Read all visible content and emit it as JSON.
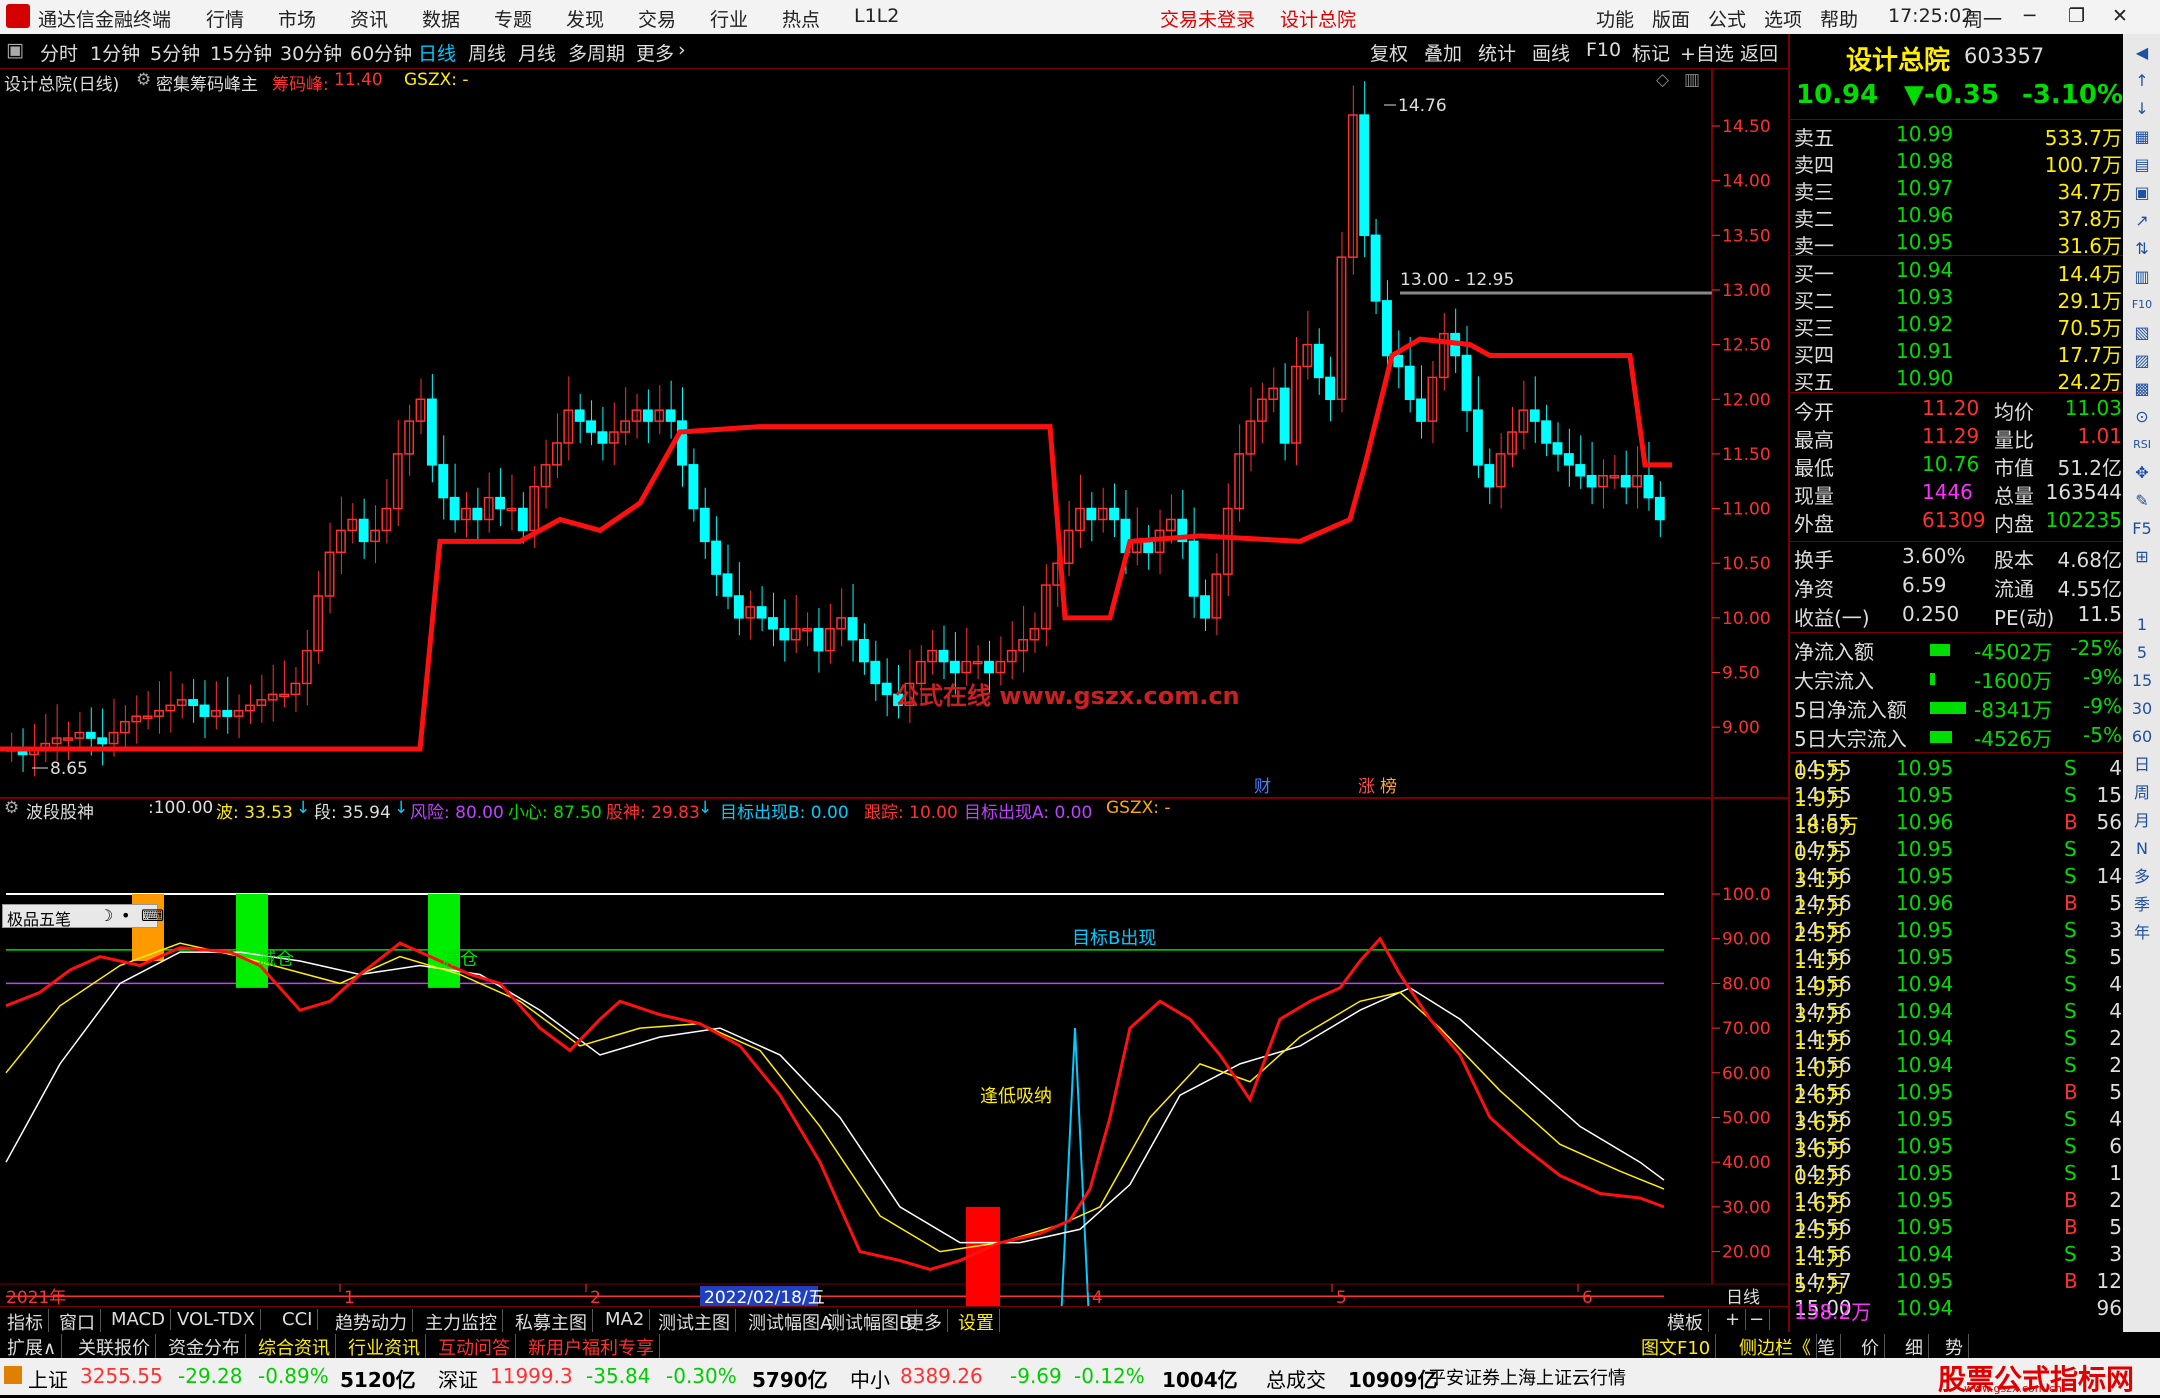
{
  "titlebar": {
    "app_name": "通达信金融终端",
    "menus": [
      "行情",
      "市场",
      "资讯",
      "数据",
      "专题",
      "发现",
      "交易",
      "行业",
      "热点",
      "L1L2"
    ],
    "trade_status": "交易未登录",
    "stock_title": "设计总院",
    "right_menus": [
      "功能",
      "版面",
      "公式",
      "选项",
      "帮助"
    ],
    "time": "17:25:02",
    "weekday": "周一"
  },
  "periods": [
    "分时",
    "1分钟",
    "5分钟",
    "15分钟",
    "30分钟",
    "60分钟",
    "日线",
    "周线",
    "月线",
    "多周期",
    "更多"
  ],
  "active_period": "日线",
  "chart_tools": [
    "复权",
    "叠加",
    "统计",
    "画线",
    "F10",
    "标记",
    "+自选",
    "返回"
  ],
  "main_chart": {
    "stock_label": "设计总院(日线)",
    "indicator_name": "密集筹码峰主",
    "peak_label": "筹码峰:",
    "peak_value": "11.40",
    "gszx": "GSZX: -",
    "high_label": "14.76",
    "low_label": "8.65",
    "range_label": "13.00 - 12.95",
    "watermark": "公式在线  www.gszx.com.cn",
    "marker_cai": "财",
    "marker_zhang": "涨",
    "marker_bang": "榜",
    "y_ticks": [
      "14.50",
      "14.00",
      "13.50",
      "13.00",
      "12.50",
      "12.00",
      "11.50",
      "11.00",
      "10.50",
      "10.00",
      "9.50",
      "9.00"
    ]
  },
  "sub_chart": {
    "name": "波段股神",
    "p0": ":100.00",
    "wave_label": "波: 33.53",
    "seg_label": "段: 35.94",
    "risk_label": "风险: 80.00",
    "careful_label": "小心: 87.50",
    "god_label": "股神: 29.83",
    "targetB_label": "目标出现B: 0.00",
    "track_label": "跟踪: 10.00",
    "targetA_label": "目标出现A: 0.00",
    "gszx": "GSZX: -",
    "toolbox_label": "极品五笔",
    "annot_reduce1": "减仓",
    "annot_reduce2": "减仓",
    "annot_buy": "逢低吸纳",
    "annot_targetB": "目标B出现",
    "y_ticks": [
      "100.0",
      "90.00",
      "80.00",
      "70.00",
      "60.00",
      "50.00",
      "40.00",
      "30.00",
      "20.00"
    ]
  },
  "time_axis": {
    "year": "2021年",
    "marks": [
      "1",
      "2",
      "4",
      "5",
      "6"
    ],
    "cursor_date": "2022/02/18/五",
    "period": "日线"
  },
  "bottom_tabs": [
    "指标",
    "窗口",
    "MACD",
    "VOL-TDX",
    "CCI",
    "趋势动力",
    "主力监控",
    "私募主图",
    "MA2",
    "测试主图",
    "测试幅图A",
    "测试幅图B",
    "更多",
    "设置"
  ],
  "bottom_right": [
    "模板",
    "+",
    "−"
  ],
  "ext_items": [
    "扩展∧",
    "关联报价",
    "资金分布",
    "综合资讯",
    "行业资讯",
    "互动问答",
    "新用户福利专享"
  ],
  "ext_right": [
    "图文F10",
    "侧边栏《",
    "笔",
    "价",
    "细",
    "势"
  ],
  "quote": {
    "name": "设计总院",
    "code": "603357",
    "price": "10.94",
    "change": "▼-0.35",
    "pct": "-3.10%",
    "asks": [
      {
        "label": "卖五",
        "p": "10.99",
        "v": "533.7万"
      },
      {
        "label": "卖四",
        "p": "10.98",
        "v": "100.7万"
      },
      {
        "label": "卖三",
        "p": "10.97",
        "v": "34.7万"
      },
      {
        "label": "卖二",
        "p": "10.96",
        "v": "37.8万"
      },
      {
        "label": "卖一",
        "p": "10.95",
        "v": "31.6万"
      }
    ],
    "bids": [
      {
        "label": "买一",
        "p": "10.94",
        "v": "14.4万"
      },
      {
        "label": "买二",
        "p": "10.93",
        "v": "29.1万"
      },
      {
        "label": "买三",
        "p": "10.92",
        "v": "70.5万"
      },
      {
        "label": "买四",
        "p": "10.91",
        "v": "17.7万"
      },
      {
        "label": "买五",
        "p": "10.90",
        "v": "24.2万"
      }
    ],
    "stats": [
      [
        "今开",
        "11.20",
        "均价",
        "11.03"
      ],
      [
        "最高",
        "11.29",
        "量比",
        "1.01"
      ],
      [
        "最低",
        "10.76",
        "市值",
        "51.2亿"
      ],
      [
        "现量",
        "1446",
        "总量",
        "163544"
      ],
      [
        "外盘",
        "61309",
        "内盘",
        "102235"
      ]
    ],
    "fund": [
      [
        "换手",
        "3.60%",
        "股本",
        "4.68亿"
      ],
      [
        "净资",
        "6.59",
        "流通",
        "4.55亿"
      ],
      [
        "收益(一)",
        "0.250",
        "PE(动)",
        "11.5"
      ]
    ],
    "flows": [
      [
        "净流入额",
        "-4502万",
        "-25%"
      ],
      [
        "大宗流入",
        "-1600万",
        "-9%"
      ],
      [
        "5日净流入额",
        "-8341万",
        "-9%"
      ],
      [
        "5日大宗流入",
        "-4526万",
        "-5%"
      ]
    ],
    "ticks": [
      [
        "14:55",
        "10.95",
        "0.5万",
        "S",
        "4"
      ],
      [
        "14:55",
        "10.95",
        "1.9万",
        "S",
        "15"
      ],
      [
        "14:55",
        "10.96",
        "18.6万",
        "B",
        "56"
      ],
      [
        "14:55",
        "10.95",
        "0.7万",
        "S",
        "2"
      ],
      [
        "14:56",
        "10.95",
        "3.1万",
        "S",
        "14"
      ],
      [
        "14:56",
        "10.96",
        "2.7万",
        "B",
        "5"
      ],
      [
        "14:56",
        "10.95",
        "2.5万",
        "S",
        "3"
      ],
      [
        "14:56",
        "10.95",
        "1.1万",
        "S",
        "5"
      ],
      [
        "14:56",
        "10.94",
        "1.9万",
        "S",
        "4"
      ],
      [
        "14:56",
        "10.94",
        "3.7万",
        "S",
        "4"
      ],
      [
        "14:56",
        "10.94",
        "1.1万",
        "S",
        "2"
      ],
      [
        "14:56",
        "10.94",
        "1.0万",
        "S",
        "2"
      ],
      [
        "14:56",
        "10.95",
        "2.6万",
        "B",
        "5"
      ],
      [
        "14:56",
        "10.95",
        "3.6万",
        "S",
        "4"
      ],
      [
        "14:56",
        "10.95",
        "3.6万",
        "S",
        "6"
      ],
      [
        "14:56",
        "10.95",
        "0.2万",
        "S",
        "1"
      ],
      [
        "14:56",
        "10.95",
        "1.6万",
        "B",
        "2"
      ],
      [
        "14:56",
        "10.95",
        "2.5万",
        "B",
        "5"
      ],
      [
        "14:56",
        "10.94",
        "1.1万",
        "S",
        "3"
      ],
      [
        "14:57",
        "10.95",
        "5.7万",
        "B",
        "12"
      ],
      [
        "15:00",
        "10.94",
        "158.2万",
        "",
        "96"
      ]
    ]
  },
  "sidebar_icons": [
    "◀",
    "↑",
    "↓",
    "▦",
    "▤",
    "▣",
    "↗",
    "⇅",
    "▥",
    "F10",
    "▧",
    "▨",
    "▩",
    "⊙",
    "RSI",
    "✥",
    "✎",
    "F5",
    "⊞",
    "1",
    "5",
    "15",
    "30",
    "60",
    "日",
    "周",
    "月",
    "N",
    "多",
    "季",
    "年"
  ],
  "statusbar": {
    "sh_label": "上证",
    "sh_val": "3255.55",
    "sh_chg": "-29.28",
    "sh_pct": "-0.89%",
    "sh_amt": "5120亿",
    "sz_label": "深证",
    "sz_val": "11999.3",
    "sz_chg": "-35.84",
    "sz_pct": "-0.30%",
    "sz_amt": "5790亿",
    "zx_label": "中小",
    "zx_val": "8389.26",
    "zx_chg": "-9.69",
    "zx_pct": "-0.12%",
    "zx_amt": "1004亿",
    "total_label": "总成交",
    "total_val": "10909亿",
    "broker": "平安证券上海上证云行情",
    "brand": "股票公式指标网",
    "brand_url": "www.gszx.com.cn"
  },
  "colors": {
    "up": "#ff3030",
    "down": "#00ffff",
    "panel_border": "#7a0000",
    "chip_line": "#ff1010"
  }
}
